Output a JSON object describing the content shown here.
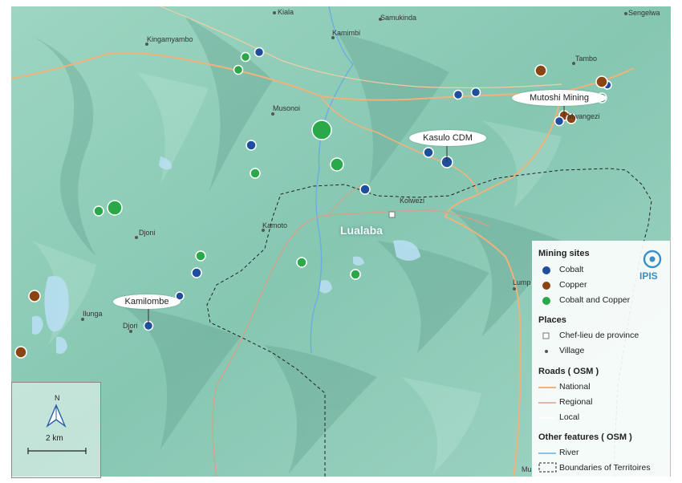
{
  "map": {
    "region_label": "Lualaba",
    "places": [
      {
        "name": "Kiala"
      },
      {
        "name": "Samukinda"
      },
      {
        "name": "Sengelwa"
      },
      {
        "name": "Kingamyambo"
      },
      {
        "name": "Kamimbi"
      },
      {
        "name": "Tambo"
      },
      {
        "name": "Musonoi"
      },
      {
        "name": "Mwangezi"
      },
      {
        "name": "Kolwezi"
      },
      {
        "name": "Djoni"
      },
      {
        "name": "Kamoto"
      },
      {
        "name": "Ilunga"
      },
      {
        "name": "Djori"
      },
      {
        "name": "Lump"
      },
      {
        "name": "Mu"
      }
    ],
    "callouts": [
      {
        "label": "Mutoshi Mining"
      },
      {
        "label": "Kasulo CDM"
      },
      {
        "label": "Kamilombe"
      }
    ]
  },
  "legend": {
    "mining_title": "Mining sites",
    "cobalt": "Cobalt",
    "copper": "Copper",
    "cobalt_copper": "Cobalt and Copper",
    "places_title": "Places",
    "chef_lieu": "Chef-lieu de province",
    "village": "Village",
    "roads_title": "Roads ( OSM )",
    "national": "National",
    "regional": "Regional",
    "local": "Local",
    "other_title": "Other features ( OSM )",
    "river": "River",
    "boundaries": "Boundaries of Territoires"
  },
  "logo": {
    "text": "IPIS"
  },
  "scale": {
    "north": "N",
    "distance": "2 km"
  },
  "colors": {
    "cobalt": "#1f4e9c",
    "copper": "#8b4513",
    "cobalt_copper": "#2aa84a",
    "national_road": "#f0b27a",
    "regional_road": "#d9a08a",
    "river": "#6aaee0",
    "terrain": "#8fcdb8",
    "logo": "#3a8fc4"
  }
}
